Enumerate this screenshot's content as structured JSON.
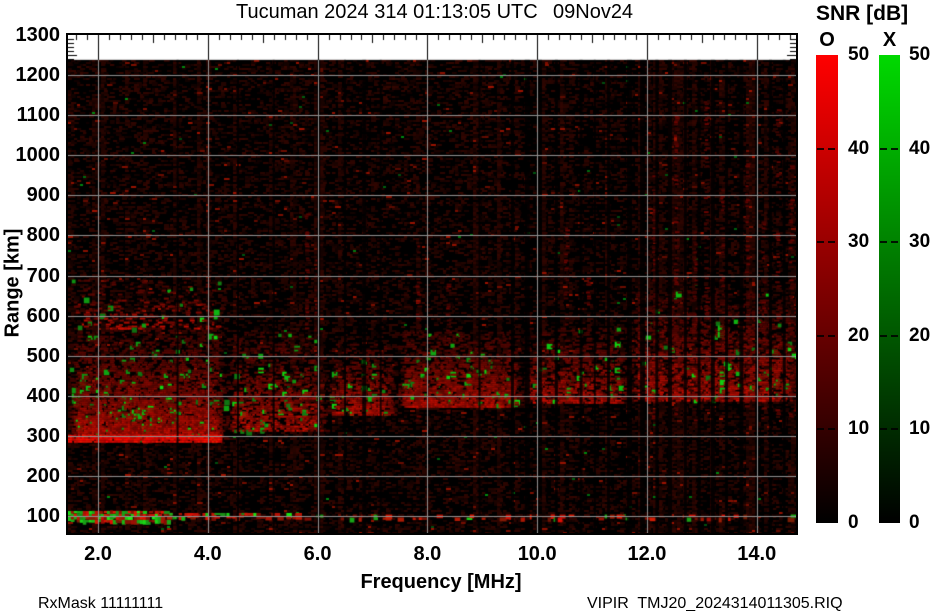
{
  "title": {
    "main": "Tucuman 2024 314 01:13:05 UTC",
    "date": "09Nov24"
  },
  "footer": {
    "left": "RxMask 11111111",
    "right": "VIPIR  TMJ20_2024314011305.RIQ"
  },
  "chart_data": {
    "type": "heatmap",
    "title": "Tucuman 2024 314 01:13:05 UTC  09Nov24",
    "xlabel": "Frequency [MHz]",
    "ylabel": "Range [km]",
    "xlim": [
      1.4536,
      14.715
    ],
    "ylim": [
      58,
      1300
    ],
    "x_major_ticks": [
      2,
      4,
      6,
      8,
      10,
      12,
      14
    ],
    "x_tick_labels": [
      "2.0",
      "4.0",
      "6.0",
      "8.0",
      "10.0",
      "12.0",
      "14.0"
    ],
    "y_major_ticks": [
      100,
      200,
      300,
      400,
      500,
      600,
      700,
      800,
      900,
      1000,
      1100,
      1200,
      1300
    ],
    "x_minor_step": 0.2,
    "y_edge_minor_step": 10,
    "grid": true,
    "grid_color": "#919191",
    "background_data_color": "#000000",
    "background_page_color": "#ffffff",
    "data_max_range_km": 1238,
    "seed": 20241109,
    "noise": {
      "density": 0.3,
      "dark_min": 14,
      "dark_max": 52,
      "bright_prob": 0.03,
      "green_prob": 0.002,
      "streak_prob": 0.14
    },
    "echo_bands": [
      {
        "f0": 1.45,
        "f1": 4.3,
        "r_bottom": 295,
        "r_top": 570,
        "density": 0.95,
        "green": 0.05
      },
      {
        "f0": 1.45,
        "f1": 4.3,
        "r_bottom": 570,
        "r_top": 700,
        "density": 0.22,
        "green": 0.012
      },
      {
        "f0": 4.3,
        "f1": 6.15,
        "r_bottom": 315,
        "r_top": 560,
        "density": 0.5,
        "green": 0.03
      },
      {
        "f0": 6.15,
        "f1": 7.4,
        "r_bottom": 355,
        "r_top": 530,
        "density": 0.68,
        "green": 0.03
      },
      {
        "f0": 7.4,
        "f1": 9.7,
        "r_bottom": 372,
        "r_top": 560,
        "density": 0.85,
        "green": 0.028
      },
      {
        "f0": 9.7,
        "f1": 11.65,
        "r_bottom": 385,
        "r_top": 570,
        "density": 0.6,
        "green": 0.02
      },
      {
        "f0": 11.65,
        "f1": 14.715,
        "r_bottom": 390,
        "r_top": 660,
        "density": 0.62,
        "green": 0.016
      }
    ],
    "bright_trace": {
      "f0": 1.45,
      "f1": 4.25,
      "r_bottom": 286,
      "r_top": 303
    },
    "ground_echoes": [
      {
        "f0": 1.45,
        "f1": 3.3,
        "r_bottom": 90,
        "r_top": 113,
        "density": 0.85,
        "green_fraction": 0.45
      },
      {
        "f0": 3.3,
        "f1": 5.6,
        "r_bottom": 94,
        "r_top": 108,
        "density": 0.45,
        "green_fraction": 0.3
      },
      {
        "f0": 5.6,
        "f1": 14.715,
        "r_bottom": 96,
        "r_top": 104,
        "density": 0.16,
        "green_fraction": 0.12
      }
    ],
    "rfi_gaps": [
      {
        "f": 3.45,
        "w": 2
      },
      {
        "f": 4.55,
        "w": 2
      },
      {
        "f": 5.2,
        "w": 2
      },
      {
        "f": 6.02,
        "w": 3
      },
      {
        "f": 6.5,
        "w": 2
      },
      {
        "f": 6.85,
        "w": 4
      },
      {
        "f": 7.15,
        "w": 2
      },
      {
        "f": 8.95,
        "w": 2
      },
      {
        "f": 9.55,
        "w": 3
      },
      {
        "f": 9.82,
        "w": 5
      },
      {
        "f": 10.05,
        "w": 4
      },
      {
        "f": 10.35,
        "w": 3
      },
      {
        "f": 10.8,
        "w": 3
      },
      {
        "f": 11.05,
        "w": 2
      },
      {
        "f": 11.3,
        "w": 3
      },
      {
        "f": 11.68,
        "w": 5
      },
      {
        "f": 11.92,
        "w": 5
      },
      {
        "f": 12.18,
        "w": 3
      },
      {
        "f": 12.42,
        "w": 4
      },
      {
        "f": 12.7,
        "w": 3
      },
      {
        "f": 12.95,
        "w": 3
      },
      {
        "f": 13.2,
        "w": 4
      },
      {
        "f": 13.45,
        "w": 3
      },
      {
        "f": 13.72,
        "w": 4
      },
      {
        "f": 14.0,
        "w": 3
      },
      {
        "f": 14.25,
        "w": 3
      },
      {
        "f": 14.5,
        "w": 3
      }
    ],
    "rfi_streaks": [
      {
        "f": 5.78,
        "top": 880
      },
      {
        "f": 5.95,
        "top": 760
      },
      {
        "f": 7.8,
        "top": 780
      },
      {
        "f": 8.35,
        "top": 700
      },
      {
        "f": 10.5,
        "top": 820
      },
      {
        "f": 10.9,
        "top": 700
      },
      {
        "f": 12.1,
        "top": 960
      },
      {
        "f": 12.5,
        "top": 1100
      },
      {
        "f": 12.85,
        "top": 820
      },
      {
        "f": 13.05,
        "top": 1150
      },
      {
        "f": 13.35,
        "top": 920
      },
      {
        "f": 13.8,
        "top": 1010
      },
      {
        "f": 14.1,
        "top": 860
      },
      {
        "f": 14.35,
        "top": 1120
      },
      {
        "f": 14.6,
        "top": 980
      },
      {
        "f": 14.68,
        "top": 700
      }
    ],
    "colorbar": {
      "title": "SNR [dB]",
      "min": 0,
      "max": 50,
      "ticks": [
        50,
        40,
        30,
        20,
        10,
        0
      ],
      "bars": [
        {
          "label": "O",
          "top_color": "#ff0000"
        },
        {
          "label": "X",
          "top_color": "#00d900"
        }
      ]
    }
  }
}
